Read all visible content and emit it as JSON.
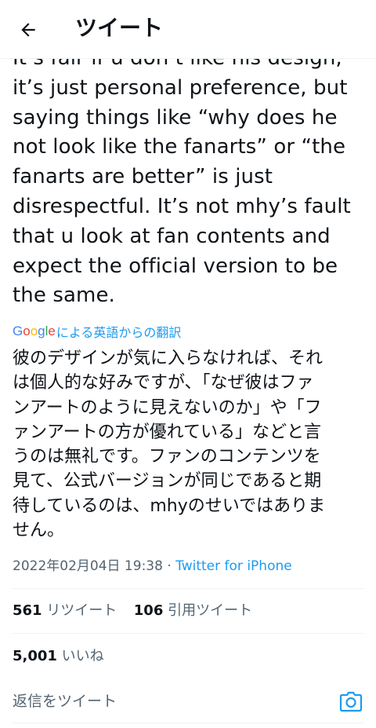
{
  "header": {
    "back_icon": "arrow-left-icon",
    "title": "ツイート"
  },
  "tweet": {
    "text": "It’s fair if u don’t like his design,\nit’s just personal preference, but\nsaying things like “why does he\nnot look like the fanarts” or “the\nfanarts are better” is just\ndisrespectful. It’s not mhy’s fault\nthat u look at fan contents and\nexpect the official version to be\nthe same.",
    "translate_link": {
      "brand": "Google",
      "label": "による英語からの翻訳"
    },
    "translated_text": "彼のデザインが気に入らなければ、それ\nは個人的な好みですが、「なぜ彼はファ\nンアートのように見えないのか」や「フ\nァンアートの方が優れている」などと言\nうのは無礼です。ファンのコンテンツを\n見て、公式バージョンが同じであると期\n待しているのは、mhyのせいではありま\nせん。",
    "timestamp": "2022年02月04日 19:38",
    "separator": " · ",
    "source": "Twitter for iPhone"
  },
  "stats": {
    "retweets_count": "561",
    "retweets_label": "リツイート",
    "quotes_count": "106",
    "quotes_label": "引用ツイート",
    "likes_count": "5,001",
    "likes_label": "いいね"
  },
  "reply": {
    "placeholder": "返信をツイート",
    "camera_icon": "camera-icon"
  },
  "colors": {
    "text": "#0f1419",
    "secondary": "#536471",
    "accent": "#1d9bf0",
    "divider": "#eff3f4"
  }
}
